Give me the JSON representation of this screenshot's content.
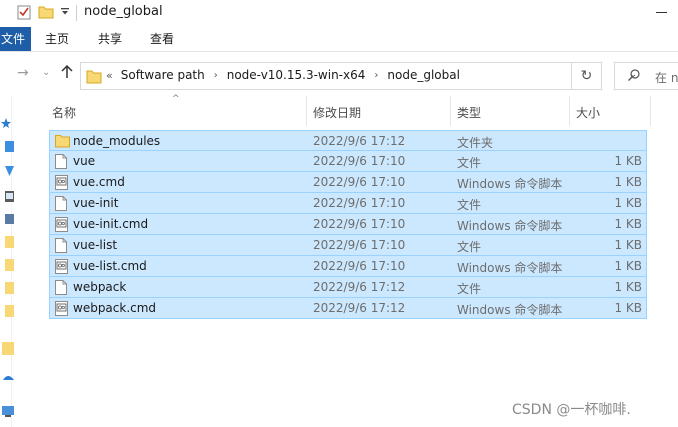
{
  "window": {
    "title": "node_global"
  },
  "ribbon": {
    "tabs": [
      {
        "label": "文件"
      },
      {
        "label": "主页"
      },
      {
        "label": "共享"
      },
      {
        "label": "查看"
      }
    ]
  },
  "address": {
    "crumbs": [
      "Software path",
      "node-v10.15.3-win-x64",
      "node_global"
    ],
    "search_placeholder": "在 n"
  },
  "columns": {
    "name": "名称",
    "date": "修改日期",
    "type": "类型",
    "size": "大小"
  },
  "files": [
    {
      "name": "node_modules",
      "date": "2022/9/6 17:12",
      "type": "文件夹",
      "size": "",
      "icon": "folder-icon"
    },
    {
      "name": "vue",
      "date": "2022/9/6 17:10",
      "type": "文件",
      "size": "1 KB",
      "icon": "file-icon"
    },
    {
      "name": "vue.cmd",
      "date": "2022/9/6 17:10",
      "type": "Windows 命令脚本",
      "size": "1 KB",
      "icon": "cmd-file-icon"
    },
    {
      "name": "vue-init",
      "date": "2022/9/6 17:10",
      "type": "文件",
      "size": "1 KB",
      "icon": "file-icon"
    },
    {
      "name": "vue-init.cmd",
      "date": "2022/9/6 17:10",
      "type": "Windows 命令脚本",
      "size": "1 KB",
      "icon": "cmd-file-icon"
    },
    {
      "name": "vue-list",
      "date": "2022/9/6 17:10",
      "type": "文件",
      "size": "1 KB",
      "icon": "file-icon"
    },
    {
      "name": "vue-list.cmd",
      "date": "2022/9/6 17:10",
      "type": "Windows 命令脚本",
      "size": "1 KB",
      "icon": "cmd-file-icon"
    },
    {
      "name": "webpack",
      "date": "2022/9/6 17:12",
      "type": "文件",
      "size": "1 KB",
      "icon": "file-icon"
    },
    {
      "name": "webpack.cmd",
      "date": "2022/9/6 17:12",
      "type": "Windows 命令脚本",
      "size": "1 KB",
      "icon": "cmd-file-icon"
    }
  ],
  "watermark": "CSDN @一杯咖啡.",
  "colors": {
    "selection_bg": "#cce8ff",
    "selection_border": "#99d1ff",
    "file_tab": "#1e5ea8",
    "folder": "#f8d775"
  }
}
